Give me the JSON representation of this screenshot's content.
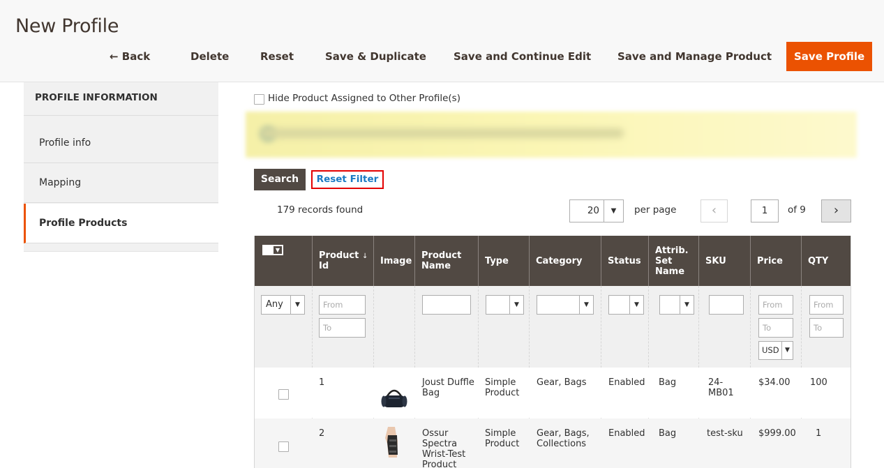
{
  "header": {
    "title": "New Profile",
    "actions": {
      "back": "← Back",
      "delete": "Delete",
      "reset": "Reset",
      "save_duplicate": "Save & Duplicate",
      "save_continue": "Save and Continue Edit",
      "save_manage": "Save and Manage Product",
      "save_profile": "Save Profile"
    }
  },
  "sidebar": {
    "title": "PROFILE INFORMATION",
    "items": [
      {
        "label": "Profile info"
      },
      {
        "label": "Mapping"
      },
      {
        "label": "Profile Products",
        "active": true
      }
    ]
  },
  "options": {
    "hide_assigned_label": "Hide Product Assigned to Other Profile(s)"
  },
  "toolbar": {
    "search_label": "Search",
    "reset_filter_label": "Reset Filter",
    "records_found": "179 records found",
    "per_page_value": "20",
    "per_page_label": "per page",
    "current_page": "1",
    "total_pages": "of 9",
    "prev_icon": "‹",
    "next_icon": "›"
  },
  "grid": {
    "columns": [
      {
        "key": "product_id",
        "label": "Product Id",
        "sort_icon": "↓"
      },
      {
        "key": "image",
        "label": "Image"
      },
      {
        "key": "name",
        "label": "Product Name"
      },
      {
        "key": "type",
        "label": "Type"
      },
      {
        "key": "category",
        "label": "Category"
      },
      {
        "key": "status",
        "label": "Status"
      },
      {
        "key": "attr_set",
        "label": "Attrib. Set Name"
      },
      {
        "key": "sku",
        "label": "SKU"
      },
      {
        "key": "price",
        "label": "Price"
      },
      {
        "key": "qty",
        "label": "QTY"
      }
    ],
    "filters": {
      "mass_select": "Any",
      "id_from": "From",
      "id_to": "To",
      "price_from": "From",
      "price_to": "To",
      "currency": "USD",
      "qty_from": "From",
      "qty_to": "To"
    },
    "rows": [
      {
        "id": "1",
        "name": "Joust Duffle Bag",
        "type": "Simple Product",
        "category": "Gear, Bags",
        "status": "Enabled",
        "attr_set": "Bag",
        "sku": "24-MB01",
        "price": "$34.00",
        "qty": "100",
        "image_icon": "duffle-bag-image"
      },
      {
        "id": "2",
        "name": "Ossur Spectra Wrist-Test Product",
        "type": "Simple Product",
        "category": "Gear, Bags, Collections",
        "status": "Enabled",
        "attr_set": "Bag",
        "sku": "test-sku",
        "price": "$999.00",
        "qty": "1",
        "image_icon": "wrist-brace-image"
      }
    ]
  },
  "colors": {
    "accent": "#eb5202",
    "grid_header": "#514943",
    "link": "#1979c3",
    "highlight_border": "#e30000"
  }
}
